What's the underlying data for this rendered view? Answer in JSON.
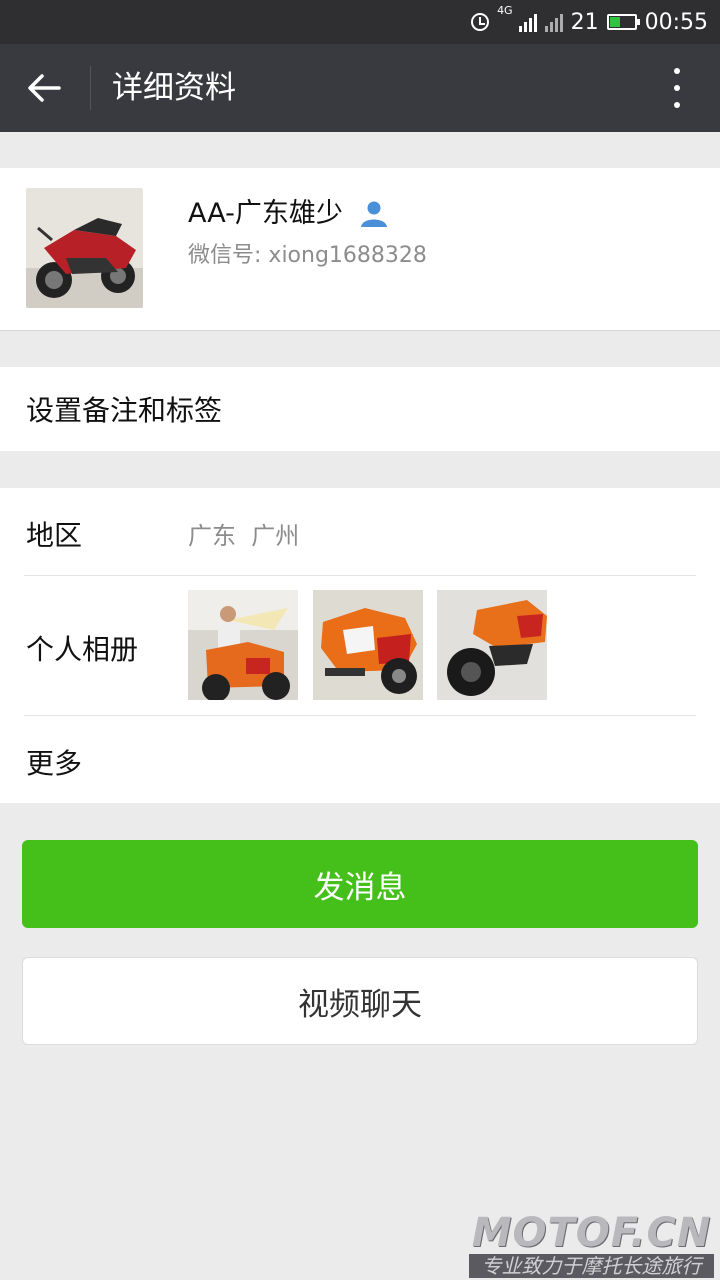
{
  "status_bar": {
    "network": "4G",
    "battery_level": "21",
    "time": "00:55"
  },
  "header": {
    "title": "详细资料"
  },
  "profile": {
    "name": "AA-广东雄少",
    "wechat_id_label": "微信号:",
    "wechat_id": "xiong1688328"
  },
  "remark": {
    "label": "设置备注和标签"
  },
  "details": {
    "region_label": "地区",
    "region_value": "广东  广州",
    "album_label": "个人相册",
    "more_label": "更多"
  },
  "actions": {
    "message_button": "发消息",
    "video_button": "视频聊天"
  },
  "watermark": {
    "brand": "MOTOF.CN",
    "slogan": "专业致力于摩托长途旅行"
  },
  "colors": {
    "primary_green": "#45c01a",
    "title_bar": "#393a3f",
    "status_bar": "#2f2f31"
  }
}
